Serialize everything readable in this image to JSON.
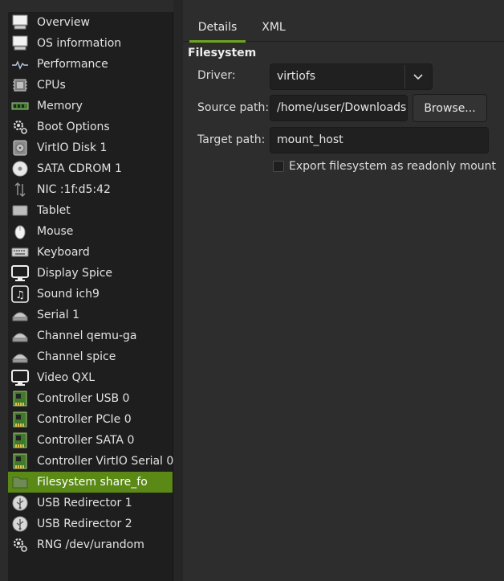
{
  "sidebar": {
    "items": [
      {
        "label": "Overview",
        "icon": "monitor-icon"
      },
      {
        "label": "OS information",
        "icon": "monitor-icon"
      },
      {
        "label": "Performance",
        "icon": "performance-graph-icon"
      },
      {
        "label": "CPUs",
        "icon": "cpu-chip-icon"
      },
      {
        "label": "Memory",
        "icon": "memory-module-icon"
      },
      {
        "label": "Boot Options",
        "icon": "gear-icon"
      },
      {
        "label": "VirtIO Disk 1",
        "icon": "hard-disk-icon"
      },
      {
        "label": "SATA CDROM 1",
        "icon": "cdrom-icon"
      },
      {
        "label": "NIC :1f:d5:42",
        "icon": "network-arrows-icon"
      },
      {
        "label": "Tablet",
        "icon": "tablet-icon"
      },
      {
        "label": "Mouse",
        "icon": "mouse-icon"
      },
      {
        "label": "Keyboard",
        "icon": "keyboard-icon"
      },
      {
        "label": "Display Spice",
        "icon": "display-icon"
      },
      {
        "label": "Sound ich9",
        "icon": "sound-icon"
      },
      {
        "label": "Serial 1",
        "icon": "serial-port-icon"
      },
      {
        "label": "Channel qemu-ga",
        "icon": "channel-icon"
      },
      {
        "label": "Channel spice",
        "icon": "channel-icon"
      },
      {
        "label": "Video QXL",
        "icon": "display-icon"
      },
      {
        "label": "Controller USB 0",
        "icon": "controller-card-icon"
      },
      {
        "label": "Controller PCIe 0",
        "icon": "controller-card-icon"
      },
      {
        "label": "Controller SATA 0",
        "icon": "controller-card-icon"
      },
      {
        "label": "Controller VirtIO Serial 0",
        "icon": "controller-card-icon"
      },
      {
        "label": "Filesystem share_fo",
        "icon": "folder-icon",
        "selected": true
      },
      {
        "label": "USB Redirector 1",
        "icon": "usb-icon"
      },
      {
        "label": "USB Redirector 2",
        "icon": "usb-icon"
      },
      {
        "label": "RNG /dev/urandom",
        "icon": "gear-icon"
      }
    ]
  },
  "tabs": {
    "details": "Details",
    "xml": "XML"
  },
  "filesystem": {
    "section_title": "Filesystem",
    "driver_label": "Driver:",
    "driver_value": "virtiofs",
    "source_label": "Source path:",
    "source_value": "/home/user/Downloads",
    "browse_label": "Browse...",
    "target_label": "Target path:",
    "target_value": "mount_host",
    "readonly_label": "Export filesystem as readonly mount",
    "readonly_checked": false
  },
  "colors": {
    "selection": "#5a8a15",
    "tab_underline": "#6ea51f",
    "background": "#2d2d2d",
    "sidebar_background": "#1e1e1e"
  }
}
